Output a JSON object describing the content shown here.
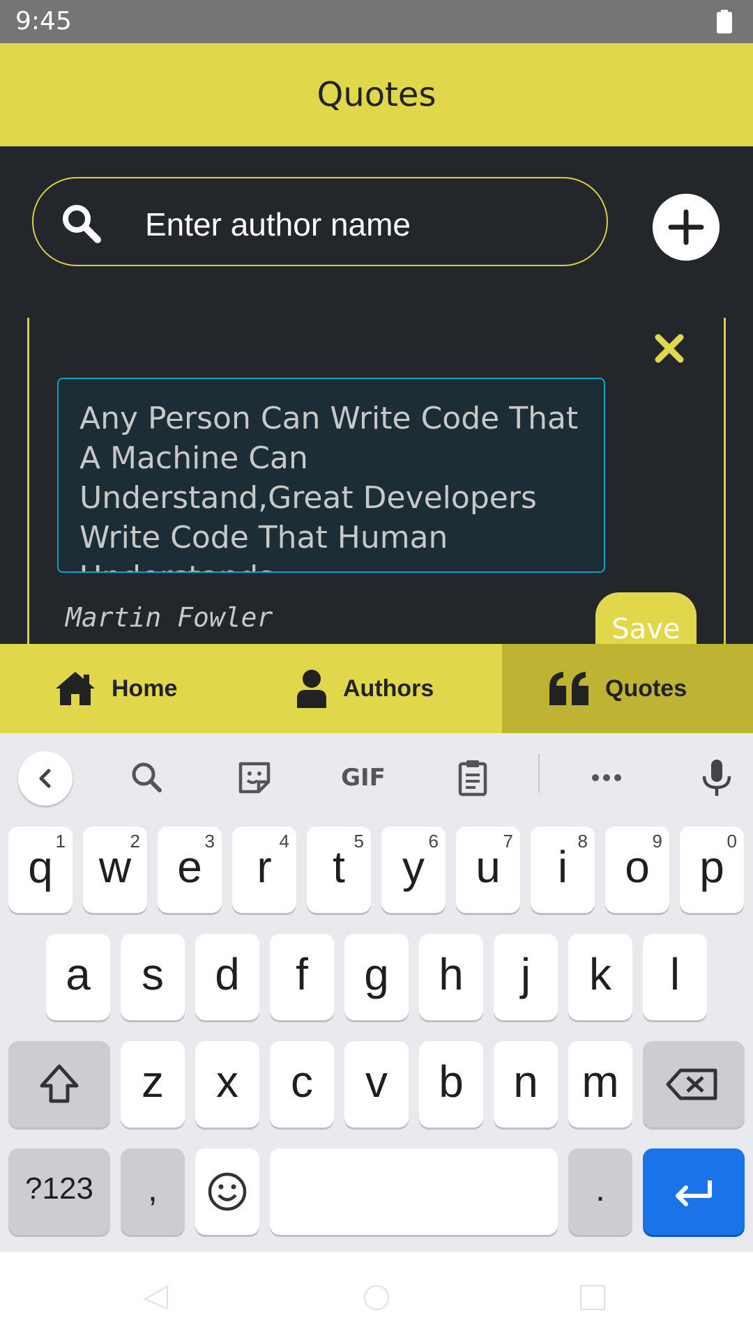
{
  "status_bar": {
    "time": "9:45"
  },
  "app_bar": {
    "title": "Quotes"
  },
  "search": {
    "placeholder": "Enter author name"
  },
  "quote_card": {
    "text": "Any Person Can Write Code That A Machine Can Understand,Great Developers Write Code That Human Understands.",
    "author": "Martin Fowler",
    "save_label": "Save"
  },
  "bottom_nav": {
    "items": [
      {
        "label": "Home",
        "icon": "home-icon"
      },
      {
        "label": "Authors",
        "icon": "person-icon"
      },
      {
        "label": "Quotes",
        "icon": "quote-icon",
        "selected": true
      }
    ]
  },
  "keyboard": {
    "toolbar": [
      "back",
      "search",
      "sticker",
      "GIF",
      "clipboard",
      "more",
      "microphone"
    ],
    "gif_label": "GIF",
    "row1": [
      {
        "key": "q",
        "hint": "1"
      },
      {
        "key": "w",
        "hint": "2"
      },
      {
        "key": "e",
        "hint": "3"
      },
      {
        "key": "r",
        "hint": "4"
      },
      {
        "key": "t",
        "hint": "5"
      },
      {
        "key": "y",
        "hint": "6"
      },
      {
        "key": "u",
        "hint": "7"
      },
      {
        "key": "i",
        "hint": "8"
      },
      {
        "key": "o",
        "hint": "9"
      },
      {
        "key": "p",
        "hint": "0"
      }
    ],
    "row2": [
      "a",
      "s",
      "d",
      "f",
      "g",
      "h",
      "j",
      "k",
      "l"
    ],
    "row3": [
      "z",
      "x",
      "c",
      "v",
      "b",
      "n",
      "m"
    ],
    "symbols_label": "?123",
    "comma_label": ",",
    "period_label": "."
  },
  "colors": {
    "accent": "#e1d74a",
    "accent_selected": "#bfb334",
    "background": "#23272b",
    "input_border": "#15a1c2",
    "enter_key": "#1a73e8"
  }
}
